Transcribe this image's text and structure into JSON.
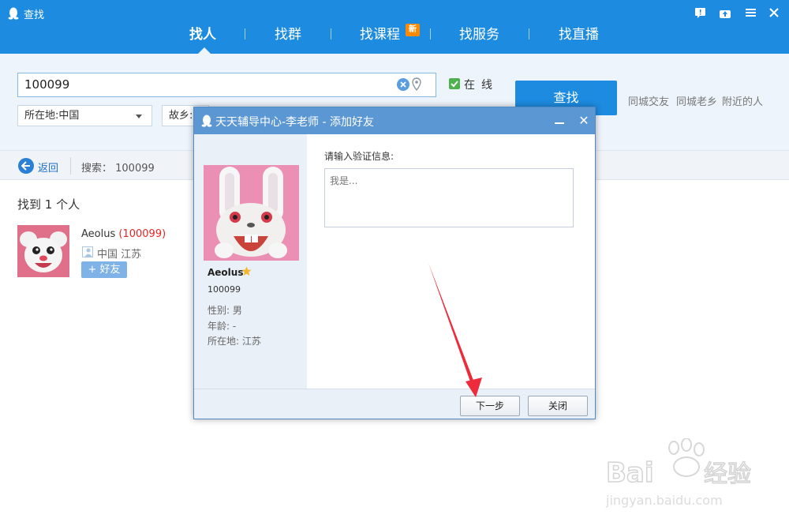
{
  "window": {
    "title": "查找"
  },
  "nav": {
    "tabs": [
      {
        "label": "找人"
      },
      {
        "label": "找群"
      },
      {
        "label": "找课程"
      },
      {
        "label": "找服务"
      },
      {
        "label": "找直播"
      }
    ],
    "new_badge": "新"
  },
  "search": {
    "value": "100099",
    "online_label": "在线",
    "find_button": "查找",
    "quick_links": [
      "同城交友",
      "同城老乡",
      "附近的人"
    ],
    "location_select": "所在地:中国",
    "hometown_select": "故乡:"
  },
  "results": {
    "back_label": "返回",
    "query_label": "搜索： 100099",
    "found_count": "找到 1 个人",
    "user": {
      "name": "Aeolus",
      "number": "(100099)",
      "location": "中国 江苏",
      "add_button": "+ 好友"
    }
  },
  "dialog": {
    "title": "天天辅导中心-李老师 - 添加好友",
    "close_glyph": "✕",
    "name": "Aeolus",
    "uin": "100099",
    "gender": "性别: 男",
    "age": "年龄: -",
    "location": "所在地: 江苏",
    "verify_label": "请输入验证信息:",
    "verify_placeholder": "我是...",
    "next_button": "下一步",
    "close_button": "关闭"
  },
  "colors": {
    "titlebar": "#1d8be0",
    "dialog_header": "#5b97d3",
    "highlight_red": "#e52525",
    "annotation_arrow": "#ee2b3a"
  },
  "icons": [
    "qq-penguin-icon",
    "feedback-icon",
    "upload-icon",
    "menu-icon",
    "minimize-icon",
    "close-icon",
    "clear-icon",
    "location-pin-icon",
    "check-icon",
    "back-arrow-icon",
    "person-icon",
    "star-icon"
  ]
}
